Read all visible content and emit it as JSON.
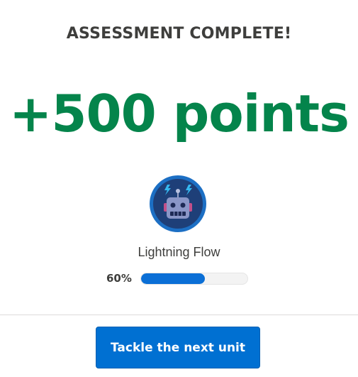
{
  "heading": "ASSESSMENT COMPLETE!",
  "points_text": "+500 points",
  "module": {
    "name": "Lightning Flow",
    "badge_icon": "robot-icon",
    "progress_label": "60%",
    "progress_value": 0.6
  },
  "cta_label": "Tackle the next unit",
  "colors": {
    "points": "#04844b",
    "accent": "#0070d2",
    "progress_fill": "#0b6fd6",
    "badge_bg": "#1e4f8f"
  }
}
